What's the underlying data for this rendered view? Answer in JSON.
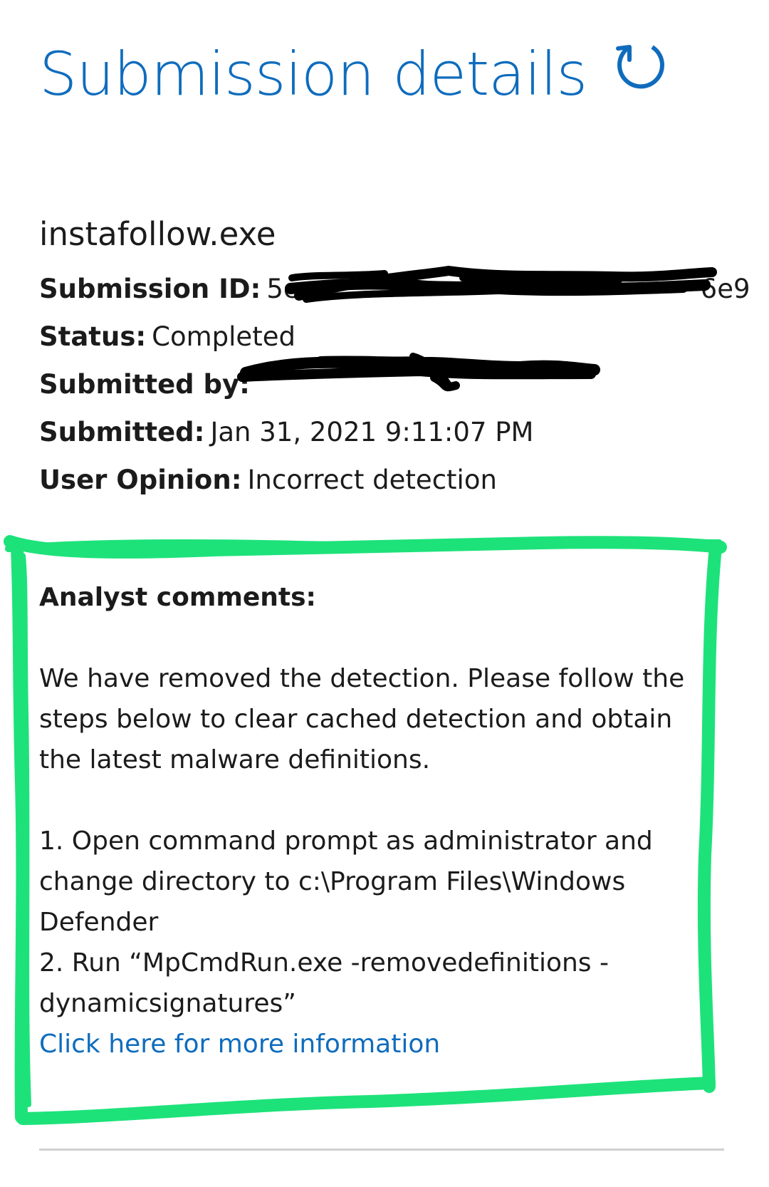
{
  "header": {
    "title": "Submission details",
    "refresh_icon": "refresh-icon",
    "accent_color": "#0f6cbd"
  },
  "submission": {
    "file_name": "instafollow.exe",
    "fields": {
      "submission_id": {
        "label": "Submission ID:",
        "value_prefix": "5e",
        "value_suffix": "6e9"
      },
      "status": {
        "label": "Status:",
        "value": "Completed"
      },
      "submitted_by": {
        "label": "Submitted by:"
      },
      "submitted": {
        "label": "Submitted:",
        "value": "Jan 31, 2021 9:11:07 PM"
      },
      "user_opinion": {
        "label": "User Opinion:",
        "value": "Incorrect detection"
      }
    }
  },
  "analyst_comments": {
    "heading": "Analyst comments:",
    "intro_lines": [
      "We have removed the detection. Please follow the",
      "steps below to clear cached detection and obtain",
      "the latest malware definitions."
    ],
    "step_lines": [
      "1. Open command prompt as administrator and",
      "change directory to c:\\Program Files\\Windows",
      "Defender",
      "2. Run “MpCmdRun.exe -removedefinitions -",
      "dynamicsignatures”"
    ],
    "link_text": "Click here for more information",
    "link_color": "#0f6cbd",
    "highlight_color": "#1de27a",
    "redaction_color": "#000000"
  }
}
